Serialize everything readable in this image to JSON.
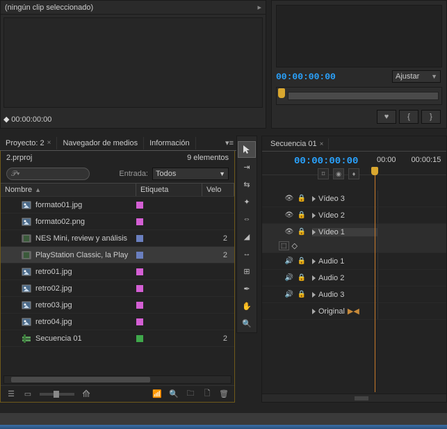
{
  "source": {
    "header": "(ningún clip seleccionado)",
    "timecode": "00:00:00:00"
  },
  "preview": {
    "timecode": "00:00:00:00",
    "fit": "Ajustar"
  },
  "tabs": {
    "project": "Proyecto: 2",
    "media_browser": "Navegador de medios",
    "info": "Información"
  },
  "project": {
    "filename": "2.prproj",
    "item_count": "9 elementos",
    "filter_label": "Entrada:",
    "filter_value": "Todos",
    "columns": {
      "name": "Nombre",
      "label": "Etiqueta",
      "velo": "Velo"
    },
    "rows": [
      {
        "icon": "image",
        "name": "formato01.jpg",
        "color": "#d45fd4",
        "velo": ""
      },
      {
        "icon": "image",
        "name": "formato02.png",
        "color": "#d45fd4",
        "velo": ""
      },
      {
        "icon": "video",
        "name": "NES Mini, review y análisis",
        "color": "#6a7fbf",
        "velo": "2"
      },
      {
        "icon": "video",
        "name": "PlayStation Classic, la Play",
        "color": "#6a7fbf",
        "velo": "2",
        "selected": true
      },
      {
        "icon": "image",
        "name": "retro01.jpg",
        "color": "#d45fd4",
        "velo": ""
      },
      {
        "icon": "image",
        "name": "retro02.jpg",
        "color": "#d45fd4",
        "velo": ""
      },
      {
        "icon": "image",
        "name": "retro03.jpg",
        "color": "#d45fd4",
        "velo": ""
      },
      {
        "icon": "image",
        "name": "retro04.jpg",
        "color": "#d45fd4",
        "velo": ""
      },
      {
        "icon": "sequence",
        "name": "Secuencia 01",
        "color": "#3fa84b",
        "velo": "2"
      }
    ]
  },
  "timeline": {
    "tab": "Secuencia 01",
    "timecode": "00:00:00:00",
    "ruler": [
      "00:00",
      "00:00:15"
    ],
    "tracks": {
      "video": [
        "Vídeo 3",
        "Vídeo 2",
        "Vídeo 1"
      ],
      "audio": [
        "Audio 1",
        "Audio 2",
        "Audio 3"
      ],
      "master": "Original"
    }
  }
}
